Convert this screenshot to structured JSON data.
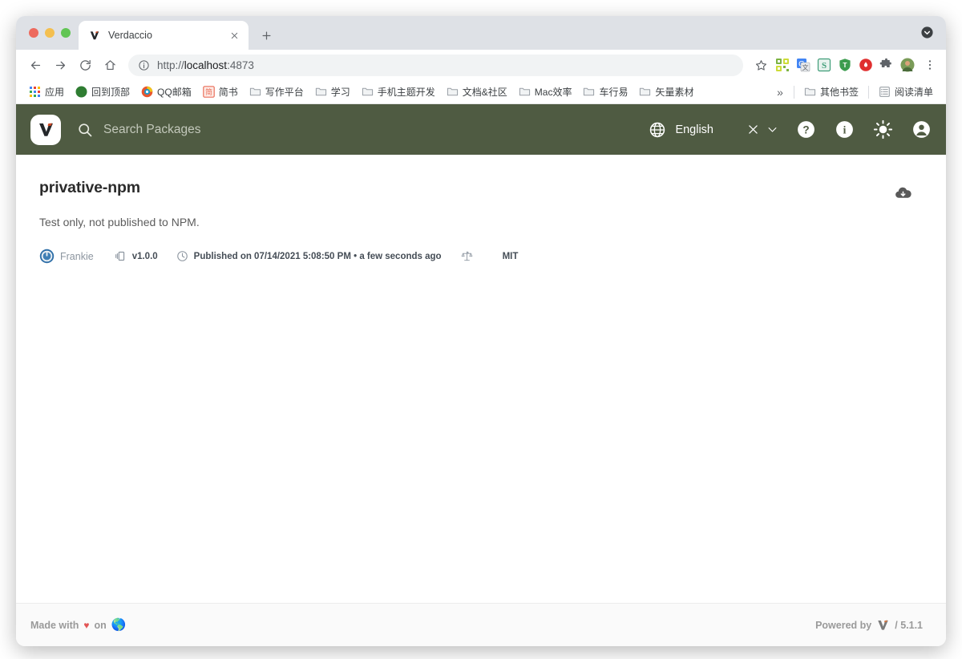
{
  "browser": {
    "window_controls": [
      "close",
      "minimize",
      "maximize"
    ],
    "tab": {
      "title": "Verdaccio",
      "favicon": "verdaccio-icon",
      "close_label": "×"
    },
    "new_tab_label": "+",
    "tab_search_icon": "chevron-down-circle-icon",
    "toolbar": {
      "back_icon": "back-arrow-icon",
      "forward_icon": "forward-arrow-icon",
      "reload_icon": "reload-icon",
      "home_icon": "home-icon",
      "info_icon": "site-info-icon",
      "url_scheme": "http://",
      "url_host": "localhost",
      "url_port": ":4873",
      "url_full": "http://localhost:4873",
      "star_icon": "bookmark-star-icon",
      "menu_icon": "three-dot-menu-icon",
      "extensions": [
        "qr-code-icon",
        "google-translate-icon",
        "evernote-icon",
        "tampermonkey-icon",
        "adblock-icon",
        "puzzle-extensions-icon",
        "profile-avatar-icon"
      ]
    },
    "bookmarks": {
      "apps_label": "应用",
      "apps_icon": "apps-grid-icon",
      "items": [
        {
          "label": "回到顶部",
          "icon": "globe-icon"
        },
        {
          "label": "QQ邮箱",
          "icon": "qq-mail-icon"
        },
        {
          "label": "简书",
          "icon": "jianshu-icon"
        },
        {
          "label": "写作平台",
          "icon": "folder-icon"
        },
        {
          "label": "学习",
          "icon": "folder-icon"
        },
        {
          "label": "手机主题开发",
          "icon": "folder-icon"
        },
        {
          "label": "文档&社区",
          "icon": "folder-icon"
        },
        {
          "label": "Mac效率",
          "icon": "folder-icon"
        },
        {
          "label": "车行易",
          "icon": "folder-icon"
        },
        {
          "label": "矢量素材",
          "icon": "folder-icon"
        }
      ],
      "overflow_label": "»",
      "other_bookmarks": {
        "label": "其他书签",
        "icon": "folder-icon"
      },
      "reading_list": {
        "label": "阅读清单",
        "icon": "reading-list-icon"
      }
    }
  },
  "app": {
    "header": {
      "logo_icon": "verdaccio-logo",
      "search_placeholder": "Search Packages",
      "search_value": "",
      "search_icon": "search-icon",
      "language_icon": "globe-language-icon",
      "language_label": "English",
      "clear_icon": "close-x-icon",
      "caret_icon": "chevron-down-icon",
      "help_icon": "help-circle-icon",
      "info_icon": "info-circle-icon",
      "theme_icon": "sun-theme-icon",
      "account_icon": "account-circle-icon",
      "background_color": "#4f5b42"
    },
    "package": {
      "name": "privative-npm",
      "description": "Test only, not published to NPM.",
      "download_icon": "cloud-download-icon",
      "author": "Frankie",
      "author_avatar_icon": "gravatar-icon",
      "version_icon": "version-tag-icon",
      "version": "v1.0.0",
      "time_icon": "clock-icon",
      "published": "Published on 07/14/2021 5:08:50 PM • a few seconds ago",
      "license_icon": "license-scales-icon",
      "license": "MIT"
    },
    "footer": {
      "made_with_prefix": "Made with",
      "heart": "♥",
      "made_with_suffix": "on",
      "earth": "🌎",
      "powered_by": "Powered by",
      "powered_logo_icon": "verdaccio-logo",
      "version": "/ 5.1.1"
    }
  }
}
